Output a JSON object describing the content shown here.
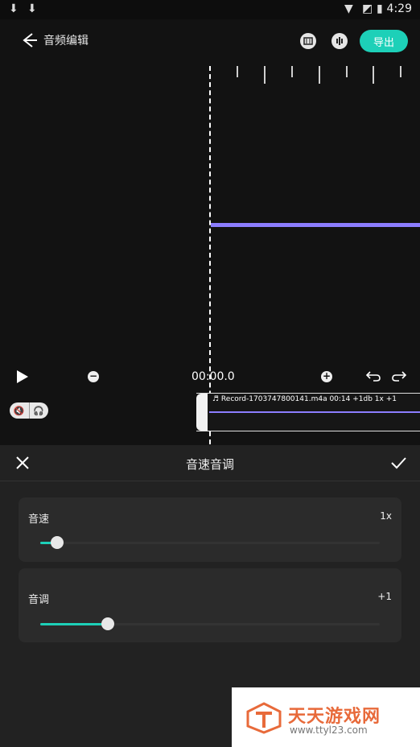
{
  "status_bar": {
    "time": "4:29",
    "left_icons": [
      "download-icon",
      "download-icon"
    ],
    "right_icons": [
      "wifi-icon",
      "no-sim-icon",
      "battery-icon"
    ]
  },
  "header": {
    "title": "音频编辑",
    "export_label": "导出",
    "icons": [
      "subtitle-icon",
      "voice-icon"
    ]
  },
  "colors": {
    "accent": "#1dd0b8",
    "waveform": "#8c7dff",
    "background": "#121212",
    "panel": "#222222"
  },
  "playback": {
    "time": "00:00.0"
  },
  "clip": {
    "label": "♬ Record-1703747800141.m4a  00:14    +1db    1x    +1"
  },
  "panel": {
    "title": "音速音调",
    "speed": {
      "label": "音速",
      "value": "1x",
      "level": 0.05
    },
    "pitch": {
      "label": "音调",
      "value": "+1",
      "level": 0.2
    }
  },
  "watermark": {
    "title": "天天游戏网",
    "url": "www.ttyl23.com"
  }
}
